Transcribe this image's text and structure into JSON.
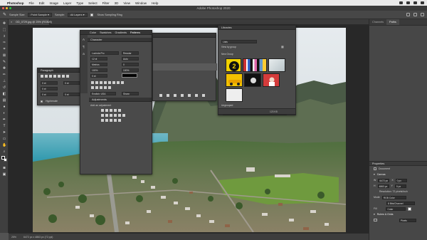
{
  "mac_menu": [
    "Photoshop",
    "File",
    "Edit",
    "Image",
    "Layer",
    "Type",
    "Select",
    "Filter",
    "3D",
    "View",
    "Window",
    "Help"
  ],
  "window_title": "Adobe Photoshop 2020",
  "options": {
    "sample_size": "Sample Size:",
    "sample_size_value": "Point Sample",
    "sample": "Sample:",
    "sample_value": "All Layers",
    "show_ring": "Show Sampling Ring"
  },
  "doc_tab": "OD_0729.jpg @ 25% (RGB/8)",
  "status": {
    "zoom": "25%",
    "doc_size": "6472 px x 4863 px (72 ppi)"
  },
  "character_panel": {
    "tabs": [
      "Color",
      "Swatches",
      "Gradients",
      "Patterns"
    ],
    "title": "Character",
    "font": "Lucinda Pro",
    "style": "Regular",
    "lang": "English: USA",
    "aa": "Sharp"
  },
  "paragraph_panel": {
    "title": "Paragraph",
    "hyphenate": "Hyphenate"
  },
  "adjustments_panel": {
    "title": "Adjustments",
    "hint": "Add an adjustment"
  },
  "libraries_panel": {
    "title": "Libraries",
    "library": "Lists",
    "view": "View by group",
    "group1": "New Group",
    "ungrouped": "Ungrouped",
    "size": "123 KB",
    "badge": "2"
  },
  "right_dock": {
    "tabs": [
      "Channels",
      "Paths"
    ],
    "properties_title": "Properties",
    "doc_label": "Document",
    "canvas_title": "Canvas",
    "width": "6472 px",
    "height": "4863 px",
    "x": "0 px",
    "y": "0 px",
    "resolution": "Resolution: 72 pixels/inch",
    "mode": "RGB Color",
    "bits": "8 Bits/Channel",
    "fill": "Color",
    "rulers_title": "Rulers & Grids",
    "units": "Pixels"
  },
  "colors": {
    "ui_dark": "#3a3a3a",
    "ui_panel": "#4a4a4a",
    "sky": "#dfe6ea",
    "ocean": "#3aa3b6"
  }
}
